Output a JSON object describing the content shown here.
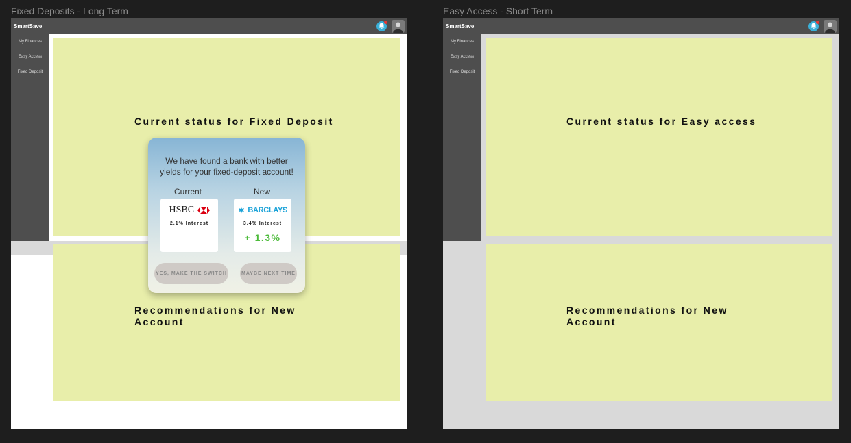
{
  "frames": [
    {
      "label": "Fixed Deposits - Long Term",
      "brand": "SmartSave",
      "nav": [
        "My Finances",
        "Easy Access",
        "Fixed Deposit"
      ],
      "panel_top": "Current status for Fixed Deposit",
      "panel_bottom": "Recommendations for New Account",
      "popup": {
        "message": "We have found a bank with better yields for your fixed-deposit account!",
        "current_label": "Current",
        "new_label": "New",
        "current_bank": "HSBC",
        "current_rate": "2.1% Interest",
        "new_bank": "BARCLAYS",
        "new_rate": "3.4% Interest",
        "difference": "+ 1.3%",
        "accept_label": "YES, MAKE THE SWITCH",
        "decline_label": "MAYBE NEXT TIME"
      }
    },
    {
      "label": "Easy Access - Short Term",
      "brand": "SmartSave",
      "nav": [
        "My Finances",
        "Easy Access",
        "Fixed Deposit"
      ],
      "panel_top": "Current status for Easy access",
      "panel_bottom": "Recommendations for New Account"
    }
  ],
  "icons": {
    "bell": "bell-icon",
    "avatar": "avatar",
    "hsbc": "hsbc-logo-icon",
    "barclays": "barclays-eagle-icon"
  },
  "colors": {
    "panel": "#e8eeaa",
    "topbar": "#4e4e4e",
    "bell": "#3ab0d8",
    "notification": "#e53935",
    "hsbc_red": "#db0011",
    "barclays_blue": "#1ca3d8",
    "positive": "#4cbb3a"
  }
}
